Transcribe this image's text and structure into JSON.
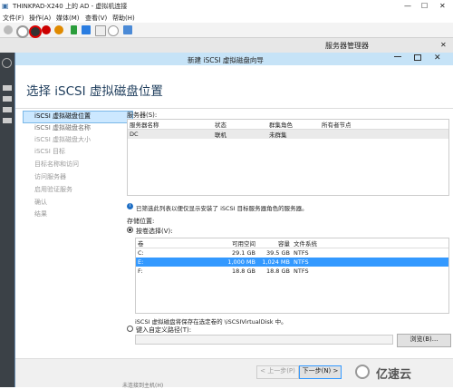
{
  "host": {
    "title": "THINKPAD-X240 上的 AD - 虚拟机连接",
    "menu": [
      "文件(F)",
      "操作(A)",
      "媒体(M)",
      "查看(V)",
      "帮助(H)"
    ],
    "minimize": "—",
    "maximize": "☐",
    "close": "✕"
  },
  "server_manager": {
    "title": "服务器管理器",
    "close": "✕"
  },
  "wizard": {
    "title": "新建 iSCSI 虚拟磁盘向导",
    "heading": "选择 iSCSI 虚拟磁盘位置",
    "nav": [
      "iSCSI 虚拟磁盘位置",
      "iSCSI 虚拟磁盘名称",
      "iSCSI 虚拟磁盘大小",
      "iSCSI 目标",
      "目标名称和访问",
      "访问服务器",
      "启用验证服务",
      "确认",
      "结果"
    ],
    "server_label": "服务器(S):",
    "server_columns": [
      "服务器名称",
      "状态",
      "群集角色",
      "所有者节点"
    ],
    "server_rows": [
      [
        "DC",
        "联机",
        "未群集",
        ""
      ]
    ],
    "info_text": "已筛选此列表以便仅显示安装了 iSCSI 目标服务器角色的服务器。",
    "storage_label": "存储位置:",
    "radio_volume": "按卷选择(V):",
    "volume_columns": [
      "卷",
      "可用空间",
      "容量",
      "文件系统"
    ],
    "volume_rows": [
      [
        "C:",
        "29.1 GB",
        "39.5 GB",
        "NTFS"
      ],
      [
        "E:",
        "1,000 MB",
        "1,024 MB",
        "NTFS"
      ],
      [
        "F:",
        "18.8 GB",
        "18.8 GB",
        "NTFS"
      ]
    ],
    "path_note": "iSCSI 虚拟磁盘将保存在选定卷的 \\iSCSIVirtualDisk 中。",
    "radio_custom": "键入自定义路径(T):",
    "browse": "浏览(B)...",
    "btn_prev": "< 上一步(P)",
    "btn_next": "下一步(N) >",
    "watermark": "亿速云",
    "footer_text": "未连接到主机(H)"
  },
  "colors": {
    "accent": "#3399ff",
    "selected_row": "#3399ff",
    "nav_selected": "#cce8ff"
  }
}
